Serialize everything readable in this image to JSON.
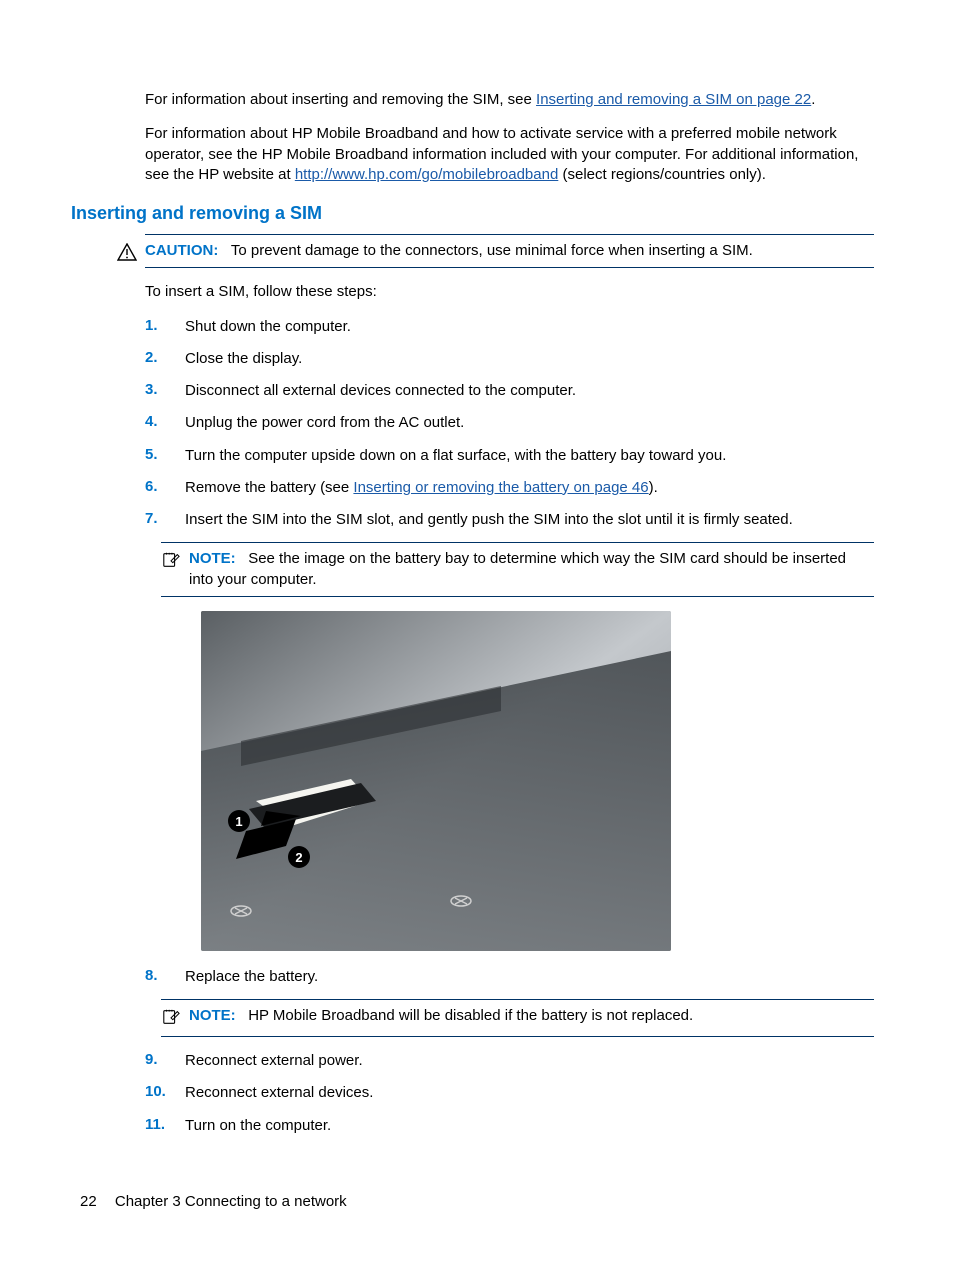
{
  "intro": {
    "p1_prefix": "For information about inserting and removing the SIM, see ",
    "p1_link": "Inserting and removing a SIM on page 22",
    "p1_suffix": ".",
    "p2_prefix": "For information about HP Mobile Broadband and how to activate service with a preferred mobile network operator, see the HP Mobile Broadband information included with your computer. For additional information, see the HP website at ",
    "p2_link": "http://www.hp.com/go/mobilebroadband",
    "p2_suffix": " (select regions/countries only)."
  },
  "heading": "Inserting and removing a SIM",
  "caution": {
    "label": "CAUTION:",
    "text": "To prevent damage to the connectors, use minimal force when inserting a SIM."
  },
  "lead": "To insert a SIM, follow these steps:",
  "steps_a": [
    {
      "n": "1.",
      "text": "Shut down the computer."
    },
    {
      "n": "2.",
      "text": "Close the display."
    },
    {
      "n": "3.",
      "text": "Disconnect all external devices connected to the computer."
    },
    {
      "n": "4.",
      "text": "Unplug the power cord from the AC outlet."
    },
    {
      "n": "5.",
      "text": "Turn the computer upside down on a flat surface, with the battery bay toward you."
    }
  ],
  "step6": {
    "n": "6.",
    "prefix": "Remove the battery (see ",
    "link": "Inserting or removing the battery on page 46",
    "suffix": ")."
  },
  "step7": {
    "n": "7.",
    "text": "Insert the SIM into the SIM slot, and gently push the SIM into the slot until it is firmly seated."
  },
  "note1": {
    "label": "NOTE:",
    "text": "See the image on the battery bay to determine which way the SIM card should be inserted into your computer."
  },
  "image": {
    "callouts": [
      "1",
      "2"
    ]
  },
  "step8": {
    "n": "8.",
    "text": "Replace the battery."
  },
  "note2": {
    "label": "NOTE:",
    "text": "HP Mobile Broadband will be disabled if the battery is not replaced."
  },
  "steps_b": [
    {
      "n": "9.",
      "text": "Reconnect external power."
    },
    {
      "n": "10.",
      "text": "Reconnect external devices."
    },
    {
      "n": "11.",
      "text": "Turn on the computer."
    }
  ],
  "footer": {
    "page": "22",
    "chapter": "Chapter 3   Connecting to a network"
  }
}
